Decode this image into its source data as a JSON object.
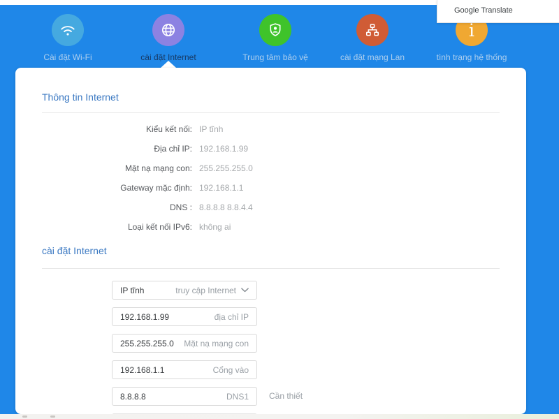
{
  "colors": {
    "header_blue": "#1f87e8",
    "wifi_circle": "#45a9e0",
    "internet_circle": "#8c82e2",
    "security_circle": "#3fc32a",
    "lan_circle": "#d05c35",
    "status_circle": "#f0a832"
  },
  "translate_popup": {
    "label": "Google Translate"
  },
  "nav": {
    "items": [
      {
        "label": "Cài đặt Wi-Fi",
        "icon": "wifi-icon",
        "color": "#45a9e0",
        "active": false
      },
      {
        "label": "cài đặt Internet",
        "icon": "globe-icon",
        "color": "#8c82e2",
        "active": true
      },
      {
        "label": "Trung tâm bảo vệ",
        "icon": "shield-icon",
        "color": "#3fc32a",
        "active": false
      },
      {
        "label": "cài đặt mạng Lan",
        "icon": "lan-icon",
        "color": "#d05c35",
        "active": false
      },
      {
        "label": "tình trạng hệ thống",
        "icon": "info-icon",
        "color": "#f0a832",
        "active": false
      }
    ]
  },
  "info_section": {
    "title": "Thông tin Internet",
    "rows": [
      {
        "label": "Kiểu kết nối:",
        "value": "IP tĩnh"
      },
      {
        "label": "Địa chỉ IP:",
        "value": "192.168.1.99"
      },
      {
        "label": "Mặt nạ mạng con:",
        "value": "255.255.255.0"
      },
      {
        "label": "Gateway mặc định:",
        "value": "192.168.1.1"
      },
      {
        "label": "DNS :",
        "value": "8.8.8.8 8.8.4.4"
      },
      {
        "label": "Loại kết nối IPv6:",
        "value": "không ai"
      }
    ]
  },
  "settings_section": {
    "title": "cài đặt Internet",
    "dropdown": {
      "value": "IP tĩnh",
      "label": "truy cập Internet"
    },
    "fields": [
      {
        "value": "192.168.1.99",
        "label": "địa chỉ IP"
      },
      {
        "value": "255.255.255.0",
        "label": "Mặt nạ mạng con"
      },
      {
        "value": "192.168.1.1",
        "label": "Cổng vào"
      },
      {
        "value": "8.8.8.8",
        "label": "DNS1",
        "note": "Cần thiết"
      }
    ]
  }
}
